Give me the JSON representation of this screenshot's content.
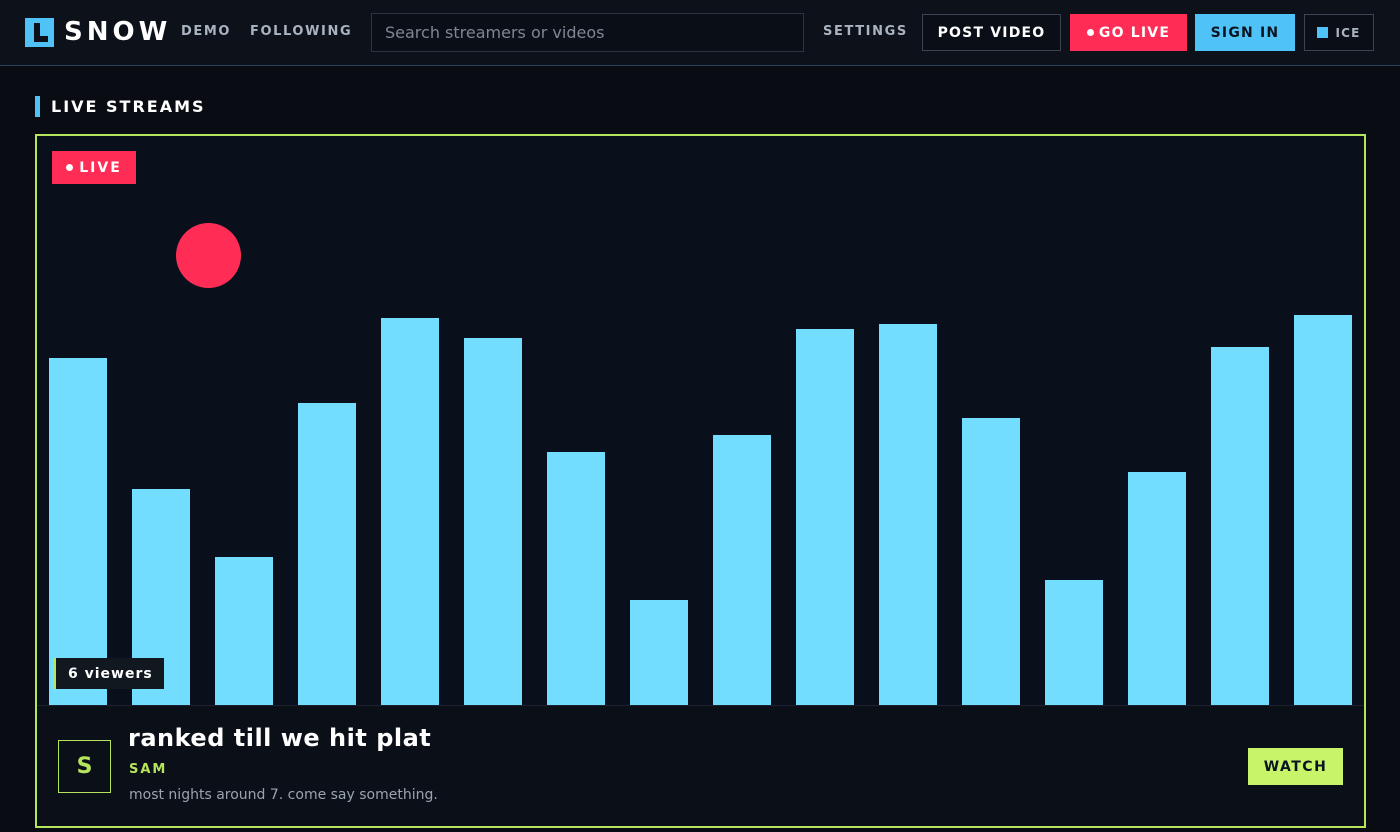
{
  "header": {
    "logo_text": "SNOW",
    "nav": [
      "DEMO",
      "FOLLOWING"
    ],
    "search_placeholder": "Search streamers or videos",
    "settings_label": "SETTINGS",
    "post_video_label": "POST VIDEO",
    "go_live_label": "GO LIVE",
    "sign_in_label": "SIGN IN",
    "theme_label": "ICE"
  },
  "section": {
    "title": "LIVE STREAMS"
  },
  "stream": {
    "live_label": "LIVE",
    "viewers_label": "6 viewers",
    "avatar_initial": "S",
    "title": "ranked till we hit plat",
    "streamer": "SAM",
    "description": "most nights around 7. come say something.",
    "watch_label": "WATCH",
    "preview_levels": [
      0.61,
      0.38,
      0.26,
      0.53,
      0.68,
      0.645,
      0.445,
      0.185,
      0.475,
      0.66,
      0.67,
      0.505,
      0.22,
      0.41,
      0.63,
      0.685
    ]
  },
  "colors": {
    "accent": "#4fc3f7",
    "live": "#ff2d55",
    "highlight": "#b6e45c",
    "bar": "#72ddfe"
  },
  "icons": [
    "logo-mark-icon",
    "live-dot-icon",
    "theme-square-icon"
  ]
}
